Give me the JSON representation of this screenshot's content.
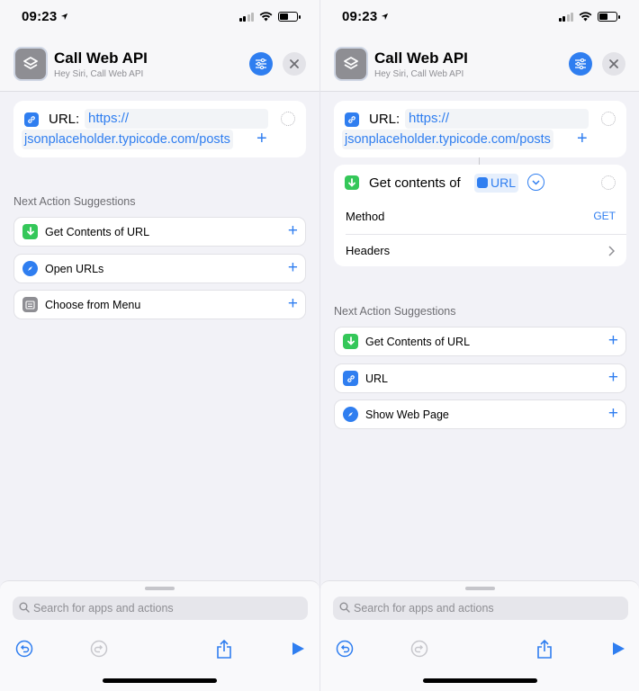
{
  "screens": [
    {
      "status": {
        "time": "09:23"
      },
      "header": {
        "title": "Call Web API",
        "subtitle": "Hey Siri, Call Web API"
      },
      "url_action": {
        "label": "URL:",
        "value_line1": "https://",
        "value_line2": "jsonplaceholder.typicode.com/posts"
      },
      "suggestions": {
        "title": "Next Action Suggestions",
        "items": [
          {
            "label": "Get Contents of URL",
            "icon": "download-icon",
            "color": "#34c759"
          },
          {
            "label": "Open URLs",
            "icon": "safari-icon",
            "color": "#2f7ef0"
          },
          {
            "label": "Choose from Menu",
            "icon": "menu-icon",
            "color": "#8e8e93"
          }
        ]
      },
      "search": {
        "placeholder": "Search for apps and actions"
      }
    },
    {
      "status": {
        "time": "09:23"
      },
      "header": {
        "title": "Call Web API",
        "subtitle": "Hey Siri, Call Web API"
      },
      "url_action": {
        "label": "URL:",
        "value_line1": "https://",
        "value_line2": "jsonplaceholder.typicode.com/posts"
      },
      "get_contents": {
        "label": "Get contents of",
        "token": "URL",
        "method_label": "Method",
        "method_value": "GET",
        "headers_label": "Headers"
      },
      "suggestions": {
        "title": "Next Action Suggestions",
        "items": [
          {
            "label": "Get Contents of URL",
            "icon": "download-icon",
            "color": "#34c759"
          },
          {
            "label": "URL",
            "icon": "link-icon",
            "color": "#2f7ef0"
          },
          {
            "label": "Show Web Page",
            "icon": "safari-icon",
            "color": "#2f7ef0"
          }
        ]
      },
      "search": {
        "placeholder": "Search for apps and actions"
      }
    }
  ],
  "colors": {
    "accent": "#2f7ef0",
    "green": "#34c759",
    "background": "#f2f2f7"
  }
}
